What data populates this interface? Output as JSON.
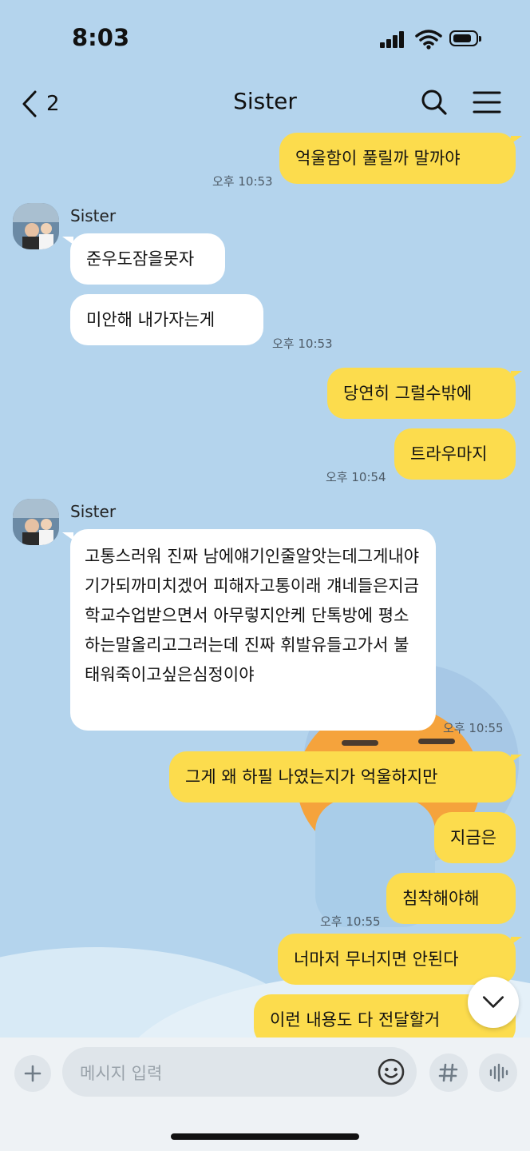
{
  "status_bar": {
    "time": "8:03"
  },
  "header": {
    "back_count": "2",
    "title": "Sister"
  },
  "messages": [
    {
      "from": "me",
      "text": "억울함이 풀릴까 말까야"
    },
    {
      "time": "오후 10:53"
    },
    {
      "sender": "Sister"
    },
    {
      "from": "other",
      "text": "준우도잠을못자"
    },
    {
      "from": "other",
      "text": "미안해 내가자는게"
    },
    {
      "time": "오후 10:53"
    },
    {
      "from": "me",
      "text": "당연히 그럴수밖에"
    },
    {
      "from": "me",
      "text": "트라우마지"
    },
    {
      "time": "오후 10:54"
    },
    {
      "sender": "Sister"
    },
    {
      "from": "other",
      "text": "고통스러워 진짜 남에얘기인줄알앗는데그게내야기가되까미치겠어 피해자고통이래 걔네들은지금학교수업받으면서 아무렇지안케 단톡방에 평소하는말올리고그러는데 진짜 휘발유들고가서 불태워죽이고싶은심정이야"
    },
    {
      "time": "오후 10:55"
    },
    {
      "from": "me",
      "text": "그게 왜 하필 나였는지가 억울하지만"
    },
    {
      "from": "me",
      "text": "지금은"
    },
    {
      "from": "me",
      "text": "침착해야해"
    },
    {
      "time": "오후 10:55"
    },
    {
      "from": "me",
      "text": "너마저 무너지면 안된다"
    },
    {
      "from": "me",
      "text": "이런 내용도 다 전달할거"
    }
  ],
  "input": {
    "placeholder": "메시지 입력"
  },
  "icons": {
    "back": "chevron-left-icon",
    "search": "search-icon",
    "menu": "hamburger-menu-icon",
    "scroll_down": "chevron-down-icon",
    "attach": "plus-icon",
    "emoji": "emoji-icon",
    "hashtag": "hashtag-icon",
    "voice": "voice-wave-icon"
  },
  "colors": {
    "background": "#b4d4ed",
    "my_bubble": "#fcdc4d",
    "their_bubble": "#ffffff"
  }
}
